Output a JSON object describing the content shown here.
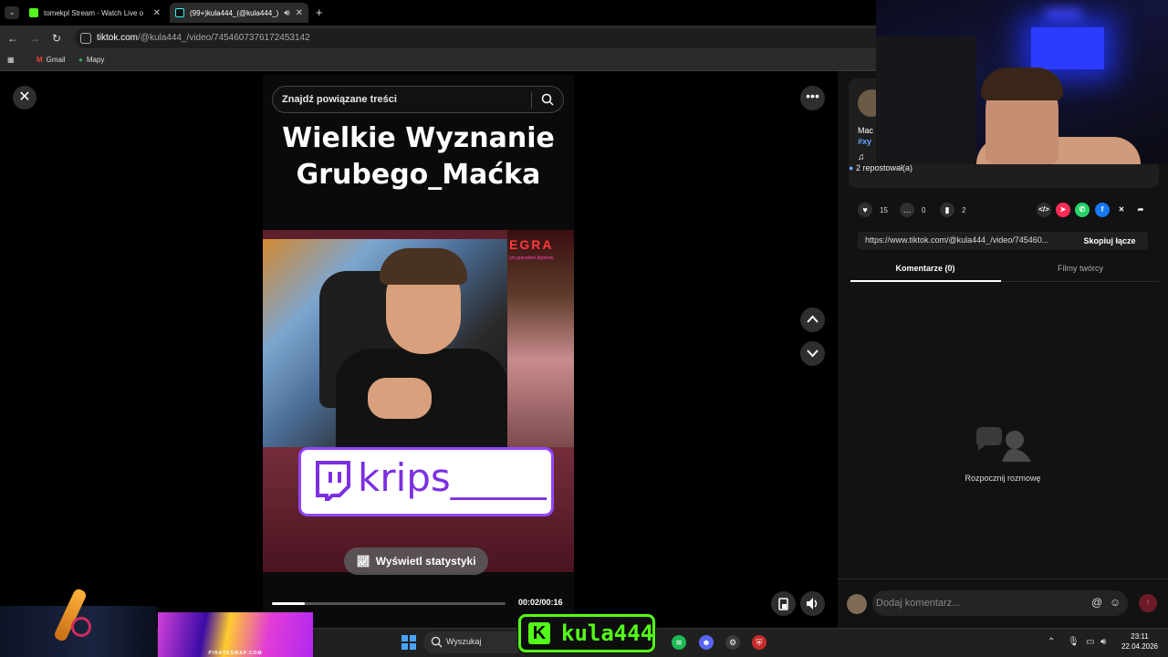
{
  "browser": {
    "tabs": [
      {
        "title": "tomekpl Stream - Watch Live o",
        "active": false
      },
      {
        "title": "(99+)kula444_(@kula444_)",
        "active": true
      }
    ],
    "new_tab": "+",
    "url_host": "tiktok.com",
    "url_path": "/@kula444_/video/7454607376172453142",
    "bookmarks": [
      "Gmail",
      "Mapy"
    ]
  },
  "viewer": {
    "search_placeholder": "Znajdź powiązane treści",
    "video_title_line1": "Wielkie Wyznanie",
    "video_title_line2": "Grubego_Maćka",
    "game_text": "EGRA",
    "game_subtext": "ym granatem błyskow",
    "twitch_handle": "krips_____",
    "stats_button": "Wyświetl statystyki",
    "time": "00:02/00:16",
    "progress_fraction": 0.14
  },
  "panel": {
    "author_name": "Mac",
    "author_tag": "#xy",
    "music_symbol": "♫",
    "reposts": "2 repostował(a)",
    "likes": "15",
    "comments": "0",
    "saves": "2",
    "share_link": "https://www.tiktok.com/@kula444_/video/745460...",
    "copy_link": "Skopiuj łącze",
    "tab_comments": "Komentarze (0)",
    "tab_creator": "Filmy twórcy",
    "empty_text": "Rozpocznij rozmowę",
    "comment_placeholder": "Dodaj komentarz...",
    "at_symbol": "@",
    "colors": {
      "accent": "#fe2c55",
      "link": "#6ba7ff"
    }
  },
  "overlay": {
    "kick_username": "kula444",
    "promo_text": "PIRATESWAP.COM"
  },
  "taskbar": {
    "search_placeholder": "Wyszukaj",
    "time": "23:11",
    "date": "22.04.2026"
  }
}
